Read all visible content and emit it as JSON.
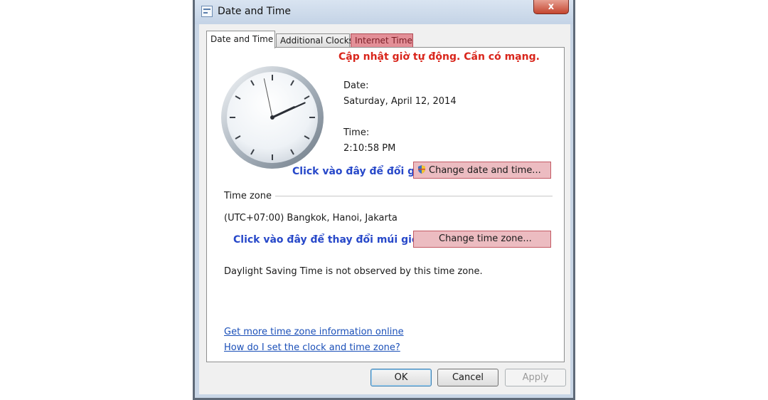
{
  "window": {
    "title": "Date and Time",
    "close_label": "x"
  },
  "tabs": [
    {
      "label": "Date and Time"
    },
    {
      "label": "Additional Clocks"
    },
    {
      "label": "Internet Time"
    }
  ],
  "annotations": {
    "internet_time": "Cập nhật giờ tự động. Cần có mạng.",
    "change_date": "Click vào đây để đổi giờ",
    "change_zone": "Click vào đây để thay đổi múi giờ =>"
  },
  "clock": {
    "hour": 2,
    "minute": 10,
    "second": 58
  },
  "date": {
    "label": "Date:",
    "value": "Saturday, April 12, 2014"
  },
  "time": {
    "label": "Time:",
    "value": "2:10:58 PM"
  },
  "buttons": {
    "change_date_time": "Change date and time...",
    "change_time_zone": "Change time zone...",
    "ok": "OK",
    "cancel": "Cancel",
    "apply": "Apply"
  },
  "timezone": {
    "section_label": "Time zone",
    "value": "(UTC+07:00) Bangkok, Hanoi, Jakarta",
    "dst_note": "Daylight Saving Time is not observed by this time zone."
  },
  "links": {
    "more_info": "Get more time zone information online",
    "how_to": "How do I set the clock and time zone?"
  },
  "colors": {
    "annotation_red": "#d9261c",
    "annotation_blue": "#2748c9",
    "highlight_fill": "#ecbcc1",
    "link": "#1a4fb8"
  }
}
